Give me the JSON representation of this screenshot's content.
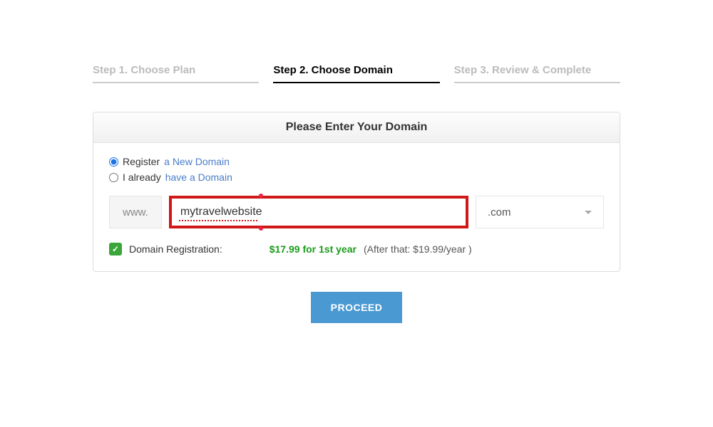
{
  "steps": {
    "s1": "Step 1. Choose Plan",
    "s2": "Step 2. Choose Domain",
    "s3": "Step 3. Review & Complete"
  },
  "panel": {
    "title": "Please Enter Your Domain"
  },
  "radios": {
    "register_pre": "Register ",
    "register_link": "a New Domain",
    "already_pre": "I already ",
    "already_link": "have a Domain"
  },
  "domain": {
    "www": "www.",
    "value": "mytravelwebsite",
    "tld": ".com"
  },
  "registration": {
    "label": "Domain Registration:",
    "price": "$17.99 for 1st year",
    "after": "(After that: $19.99/year )"
  },
  "proceed": "PROCEED"
}
